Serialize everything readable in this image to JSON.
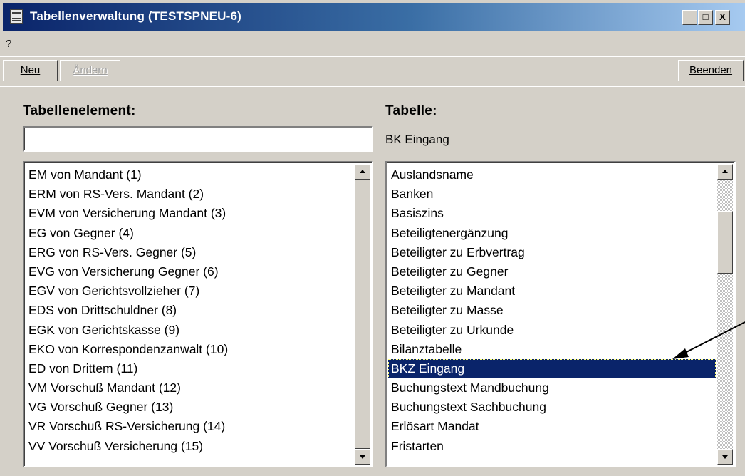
{
  "window": {
    "title": "Tabellenverwaltung (TESTSPNEU-6)",
    "controls": {
      "minimize": "_",
      "maximize": "□",
      "close": "X"
    }
  },
  "menu": {
    "help": "?"
  },
  "toolbar": {
    "new_label": "Neu",
    "edit_label": "Ändern",
    "exit_label": "Beenden"
  },
  "left_panel": {
    "label": "Tabellenelement:",
    "input_value": "",
    "items": [
      "EM  von Mandant (1)",
      "ERM von RS-Vers. Mandant (2)",
      "EVM von Versicherung Mandant (3)",
      "EG  von Gegner (4)",
      "ERG von RS-Vers. Gegner (5)",
      "EVG von Versicherung Gegner (6)",
      "EGV von Gerichtsvollzieher (7)",
      "EDS von Drittschuldner (8)",
      "EGK von Gerichtskasse (9)",
      "EKO von Korrespondenzanwalt (10)",
      "ED  von Drittem (11)",
      "VM  Vorschuß Mandant (12)",
      "VG  Vorschuß Gegner (13)",
      "VR  Vorschuß RS-Versicherung (14)",
      "VV  Vorschuß Versicherung (15)"
    ]
  },
  "right_panel": {
    "label": "Tabelle:",
    "current_table": "BK Eingang",
    "selected_index": 10,
    "items": [
      "Auslandsname",
      "Banken",
      "Basiszins",
      "Beteiligtenergänzung",
      "Beteiligter zu Erbvertrag",
      "Beteiligter zu Gegner",
      "Beteiligter zu Mandant",
      "Beteiligter zu Masse",
      "Beteiligter zu Urkunde",
      "Bilanztabelle",
      "BKZ Eingang",
      "Buchungstext Mandbuchung",
      "Buchungstext Sachbuchung",
      "Erlösart Mandat",
      "Fristarten"
    ]
  },
  "colors": {
    "titlebar_start": "#0a246a",
    "titlebar_end": "#a6caf0",
    "selection": "#0a246a",
    "face": "#d4d0c8"
  }
}
